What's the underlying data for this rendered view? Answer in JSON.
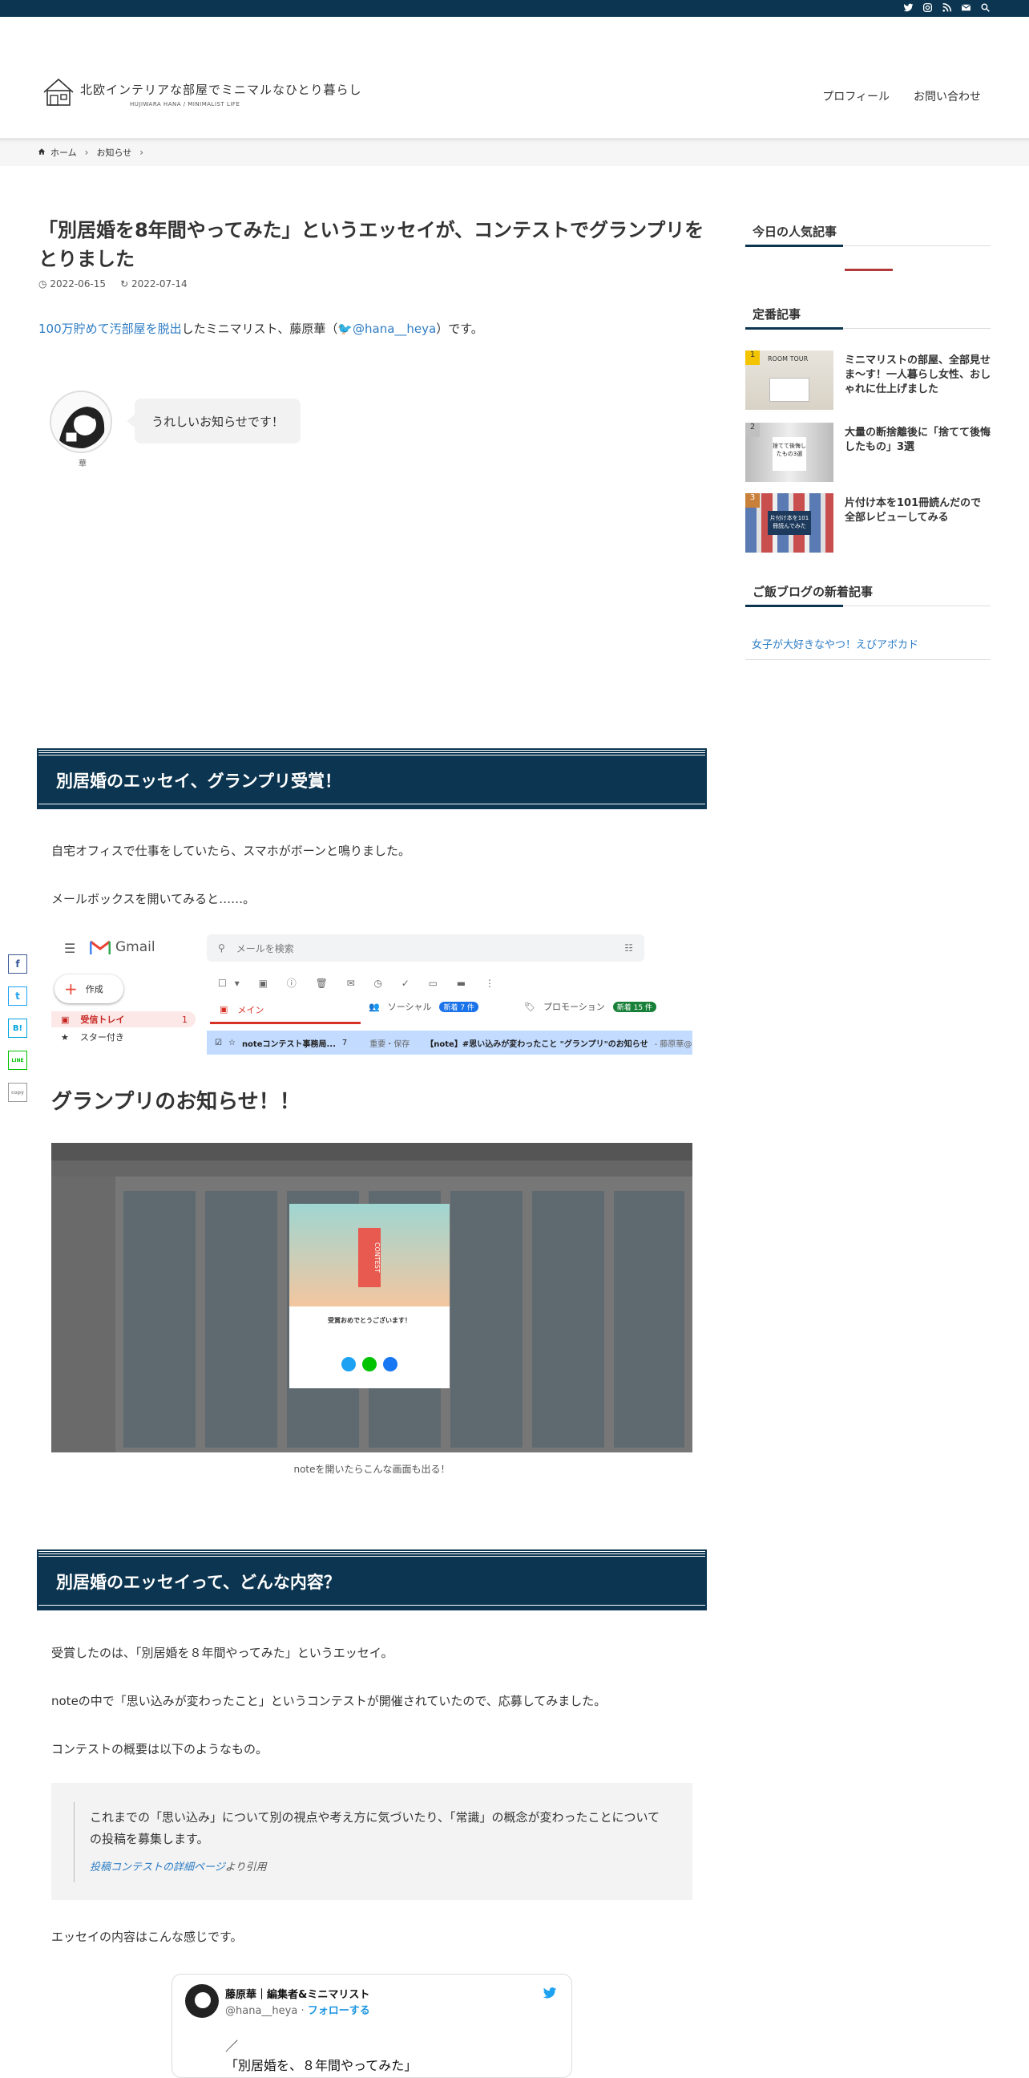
{
  "header": {
    "site_title": "北欧インテリアな部屋でミニマルなひとり暮らし",
    "site_subtitle": "HUJIWARA HANA / MINIMALIST LIFE",
    "nav": [
      "プロフィール",
      "お問い合わせ"
    ]
  },
  "topbar": {
    "icons": [
      "twitter-icon",
      "instagram-icon",
      "rss-icon",
      "mail-icon",
      "search-icon"
    ]
  },
  "breadcrumb": {
    "home": "ホーム",
    "current": "お知らせ"
  },
  "article": {
    "title": "「別居婚を8年間やってみた」というエッセイが、コンテストでグランプリをとりました",
    "published": "2022-06-15",
    "updated": "2022-07-14",
    "intro_link": "100万貯めて汚部屋を脱出",
    "intro_mid": "したミニマリスト、藤原華（",
    "intro_handle": "@hana__heya",
    "intro_end": "）です。",
    "avatar_name": "華",
    "bubble": "うれしいお知らせです！",
    "h2_1": "別居婚のエッセイ、グランプリ受賞！",
    "p1": "自宅オフィスで仕事をしていたら、スマホがボーンと鳴りました。",
    "p2": "メールボックスを開いてみると……。",
    "h3": "グランプリのお知らせ！！",
    "caption": "noteを開いたらこんな画面も出る！",
    "h2_2": "別居婚のエッセイって、どんな内容？",
    "p3": "受賞したのは、「別居婚を８年間やってみた」というエッセイ。",
    "p4": "noteの中で「思い込みが変わったこと」というコンテストが開催されていたので、応募してみました。",
    "p5": "コンテストの概要は以下のようなもの。",
    "quote": "これまでの「思い込み」について別の視点や考え方に気づいたり、「常識」の概念が変わったことについての投稿を募集します。",
    "quote_link": "投稿コンテストの詳細ページ",
    "quote_suffix": "より引用",
    "p6": "エッセイの内容はこんな感じです。"
  },
  "gmail": {
    "logo": "Gmail",
    "search_placeholder": "メールを検索",
    "compose": "作成",
    "inbox": "受信トレイ",
    "inbox_count": "1",
    "starred": "スター付き",
    "tab_main": "メイン",
    "tab_social": "ソーシャル",
    "tab_social_badge": "新着 7 件",
    "tab_promo": "プロモーション",
    "tab_promo_badge": "新着 15 件",
    "mail_from": "noteコンテスト事務局...",
    "mail_count": "7",
    "mail_tag": "重要・保存",
    "mail_subject": "【note】#思い込みが変わったこと \"グランプリ\"のお知らせ",
    "mail_preview": "- 藤原華@"
  },
  "note_popup": {
    "contest": "CONTEST",
    "congrats": "受賞おめでとうございます！"
  },
  "tweet": {
    "name": "藤原華｜編集者&ミニマリスト",
    "handle": "@hana__heya",
    "follow": "フォローする",
    "text_line1": "／",
    "text_line2": "「別居婚を、８年間やってみた」"
  },
  "sidebar": {
    "popular_heading": "今日の人気記事",
    "standard_heading": "定番記事",
    "posts": [
      {
        "title": "ミニマリストの部屋、全部見せま～す！一人暮らし女性、おしゃれに仕上げました",
        "thumb_text": "ROOM TOUR",
        "badge": "1"
      },
      {
        "title": "大量の断捨離後に「捨てて後悔したもの」3選",
        "thumb_text": "捨てて後悔したもの3選",
        "badge": "2"
      },
      {
        "title": "片付け本を101冊読んだので全部レビューしてみる",
        "thumb_text": "片付け本を101冊読んでみた",
        "badge": "3"
      }
    ],
    "food_heading": "ご飯ブログの新着記事",
    "food_link": "女子が大好きなやつ！えびアボカド"
  },
  "share": [
    "f",
    "t",
    "B!",
    "LINE",
    "copy"
  ],
  "colors": {
    "navy": "#0b3550",
    "link": "#2d7cc4",
    "accent_red": "#b33a3a"
  }
}
